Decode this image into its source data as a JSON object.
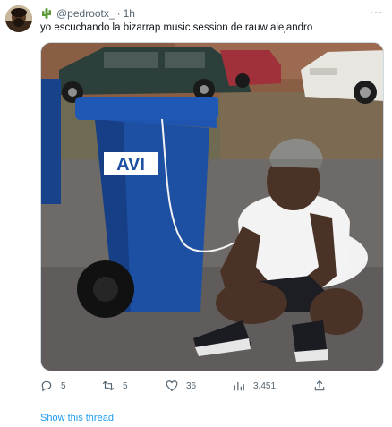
{
  "tweet": {
    "handle": "@pedrootx_",
    "separator": "·",
    "time": "1h",
    "text": "yo escuchando la bizarrap music session de rauw alejandro",
    "more_label": "···",
    "icons": {
      "emoji": "cactus-emoji",
      "more": "more-options-icon"
    },
    "image_logo_text": "AVI"
  },
  "actions": {
    "replies": "5",
    "retweets": "5",
    "likes": "36",
    "views": "3,451"
  },
  "footer": {
    "show_thread": "Show this thread"
  },
  "colors": {
    "link": "#1d9bf0",
    "muted": "#536471",
    "text": "#0f1419",
    "bin_blue": "#1d4fa3"
  }
}
